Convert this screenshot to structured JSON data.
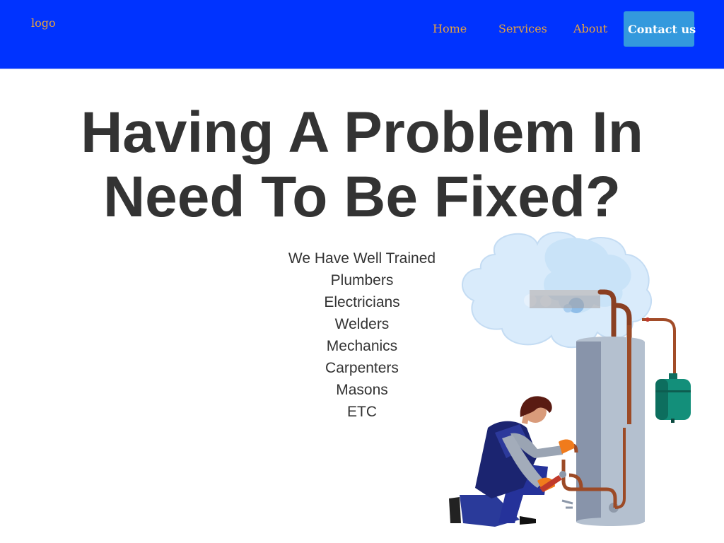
{
  "nav": {
    "logo": "logo",
    "links": [
      "Home",
      "Services",
      "About"
    ],
    "cta": "Contact us"
  },
  "hero": {
    "title_line1": "Having A Problem In",
    "title_line2": "Need To Be Fixed?",
    "intro": "We Have Well Trained",
    "trades": [
      "Plumbers",
      "Electricians",
      "Welders",
      "Mechanics",
      "Carpenters",
      "Masons",
      "ETC"
    ]
  },
  "illustration": {
    "name": "plumber-fixing-water-heater-illustration"
  },
  "colors": {
    "nav_bg": "#0033ff",
    "nav_link": "#e8a33d",
    "cta_bg": "#3399dd",
    "heading": "#333333"
  }
}
